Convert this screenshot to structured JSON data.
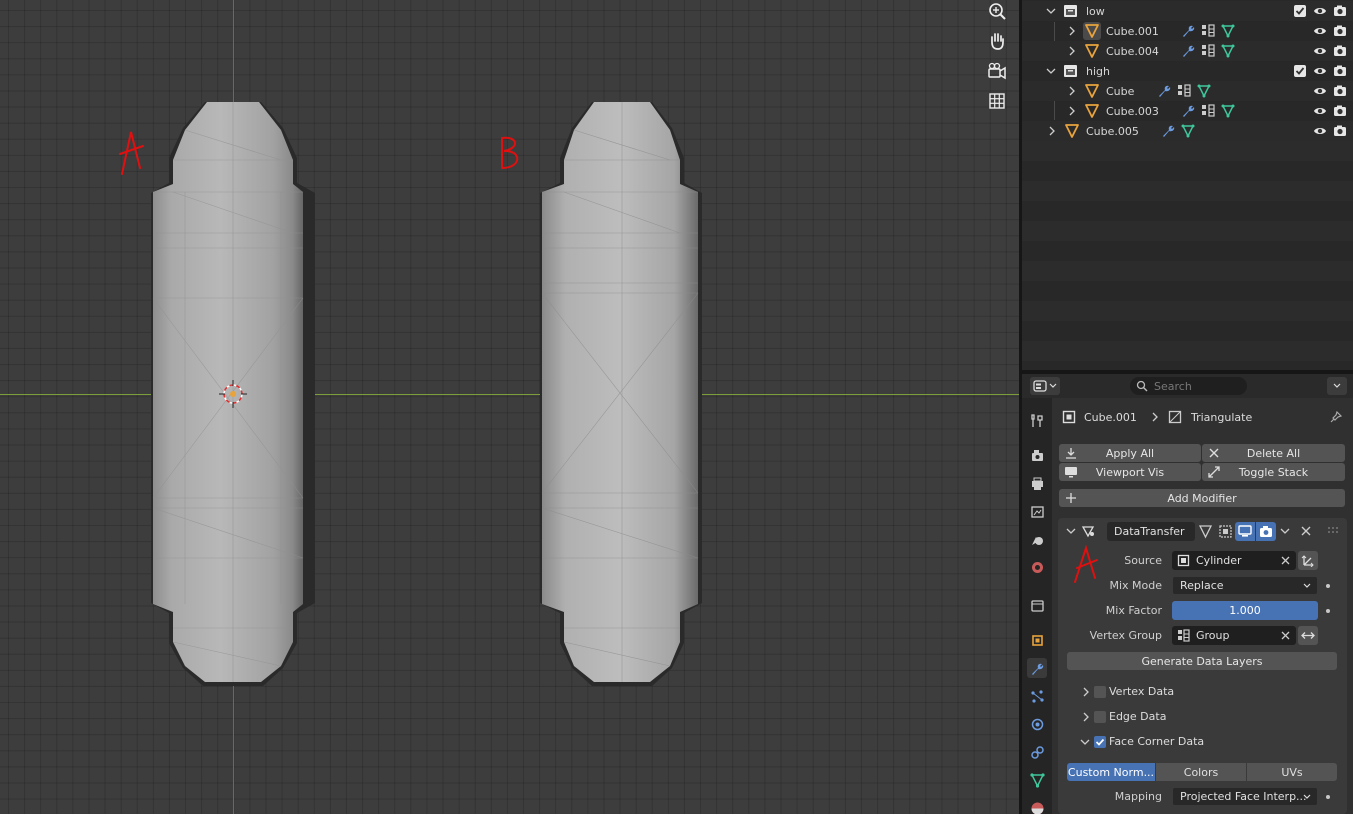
{
  "viewport": {
    "annotation_a": "A",
    "annotation_b": "B"
  },
  "outliner": {
    "rows": [
      {
        "name": "low"
      },
      {
        "name": "Cube.001"
      },
      {
        "name": "Cube.004"
      },
      {
        "name": "high"
      },
      {
        "name": "Cube"
      },
      {
        "name": "Cube.003"
      },
      {
        "name": "Cube.005"
      }
    ]
  },
  "properties": {
    "search_placeholder": "Search",
    "breadcrumb_object": "Cube.001",
    "breadcrumb_modifier": "Triangulate",
    "apply_all": "Apply All",
    "delete_all": "Delete All",
    "viewport_vis": "Viewport Vis",
    "toggle_stack": "Toggle Stack",
    "add_modifier": "Add Modifier",
    "modifier_name": "DataTransfer",
    "annotation_a": "A",
    "source_label": "Source",
    "source_value": "Cylinder",
    "mix_mode_label": "Mix Mode",
    "mix_mode_value": "Replace",
    "mix_factor_label": "Mix Factor",
    "mix_factor_value": "1.000",
    "vertex_group_label": "Vertex Group",
    "vertex_group_value": "Group",
    "generate_data_layers": "Generate Data Layers",
    "vertex_data": "Vertex Data",
    "edge_data": "Edge Data",
    "face_corner_data": "Face Corner Data",
    "tabs": [
      "Custom Norm...",
      "Colors",
      "UVs"
    ],
    "mapping_label": "Mapping",
    "mapping_value": "Projected Face Interp..."
  },
  "colors": {
    "accent": "#4772b3",
    "annotation": "#e01010",
    "mesh_icon": "#e8a33c",
    "vertex_icon": "#3fc79c",
    "wrench_icon": "#6c9be0"
  }
}
